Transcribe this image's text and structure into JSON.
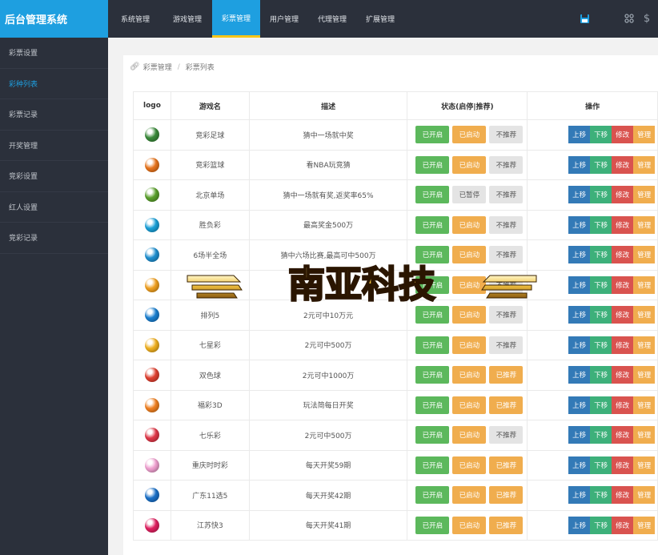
{
  "app": {
    "title": "后台管理系统"
  },
  "sidebar": {
    "items": [
      {
        "label": "彩票设置",
        "active": false
      },
      {
        "label": "彩种列表",
        "active": true
      },
      {
        "label": "彩票记录",
        "active": false
      },
      {
        "label": "开奖管理",
        "active": false
      },
      {
        "label": "竞彩设置",
        "active": false
      },
      {
        "label": "红人设置",
        "active": false
      },
      {
        "label": "竞彩记录",
        "active": false
      }
    ]
  },
  "topnav": {
    "tabs": [
      {
        "label": "系统管理",
        "active": false
      },
      {
        "label": "游戏管理",
        "active": false
      },
      {
        "label": "彩票管理",
        "active": true
      },
      {
        "label": "用户管理",
        "active": false
      },
      {
        "label": "代理管理",
        "active": false
      },
      {
        "label": "扩展管理",
        "active": false
      }
    ],
    "icons": [
      "save-icon",
      "apps-icon",
      "dollar-icon"
    ]
  },
  "breadcrumb": {
    "items": [
      "彩票管理",
      "彩票列表"
    ]
  },
  "table": {
    "headers": {
      "logo": "logo",
      "name": "游戏名",
      "desc": "描述",
      "status": "状态(启停|推荐)",
      "ops": "操作"
    },
    "op_labels": {
      "up": "上移",
      "down": "下移",
      "edit": "修改",
      "manage": "管理"
    },
    "rows": [
      {
        "name": "竞彩足球",
        "desc": "猜中一场就中奖",
        "open": "已开启",
        "launch": "已启动",
        "rec": "不推荐",
        "logo_color": "#3a8a3a"
      },
      {
        "name": "竞彩篮球",
        "desc": "看NBA玩竞猜",
        "open": "已开启",
        "launch": "已启动",
        "rec": "不推荐",
        "logo_color": "#e8741c"
      },
      {
        "name": "北京单场",
        "desc": "猜中一场就有奖,返奖率65%",
        "open": "已开启",
        "launch": "已暂停",
        "rec": "不推荐",
        "logo_color": "#5aa02c"
      },
      {
        "name": "胜负彩",
        "desc": "最高奖金500万",
        "open": "已开启",
        "launch": "已启动",
        "rec": "不推荐",
        "logo_color": "#1aa0d8"
      },
      {
        "name": "6场半全场",
        "desc": "猜中六场比赛,最高可中500万",
        "open": "已开启",
        "launch": "已启动",
        "rec": "不推荐",
        "logo_color": "#1f8fd0"
      },
      {
        "name": "",
        "desc": "",
        "open": "已开启",
        "launch": "已启动",
        "rec": "不推荐",
        "logo_color": "#f0a020"
      },
      {
        "name": "排列5",
        "desc": "2元可中10万元",
        "open": "已开启",
        "launch": "已启动",
        "rec": "不推荐",
        "logo_color": "#1a7fd0"
      },
      {
        "name": "七星彩",
        "desc": "2元可中500万",
        "open": "已开启",
        "launch": "已启动",
        "rec": "不推荐",
        "logo_color": "#f0b020"
      },
      {
        "name": "双色球",
        "desc": "2元可中1000万",
        "open": "已开启",
        "launch": "已启动",
        "rec": "已推荐",
        "logo_color": "#e04030"
      },
      {
        "name": "福彩3D",
        "desc": "玩法简每日开奖",
        "open": "已开启",
        "launch": "已启动",
        "rec": "已推荐",
        "logo_color": "#f08020"
      },
      {
        "name": "七乐彩",
        "desc": "2元可中500万",
        "open": "已开启",
        "launch": "已启动",
        "rec": "不推荐",
        "logo_color": "#e03848"
      },
      {
        "name": "重庆时时彩",
        "desc": "每天开奖59期",
        "open": "已开启",
        "launch": "已启动",
        "rec": "已推荐",
        "logo_color": "#f0a0d0"
      },
      {
        "name": "广东11选5",
        "desc": "每天开奖42期",
        "open": "已开启",
        "launch": "已启动",
        "rec": "已推荐",
        "logo_color": "#1a70c8"
      },
      {
        "name": "江苏快3",
        "desc": "每天开奖41期",
        "open": "已开启",
        "launch": "已启动",
        "rec": "已推荐",
        "logo_color": "#e02060"
      }
    ]
  },
  "watermark": {
    "text": "南亚科技"
  }
}
